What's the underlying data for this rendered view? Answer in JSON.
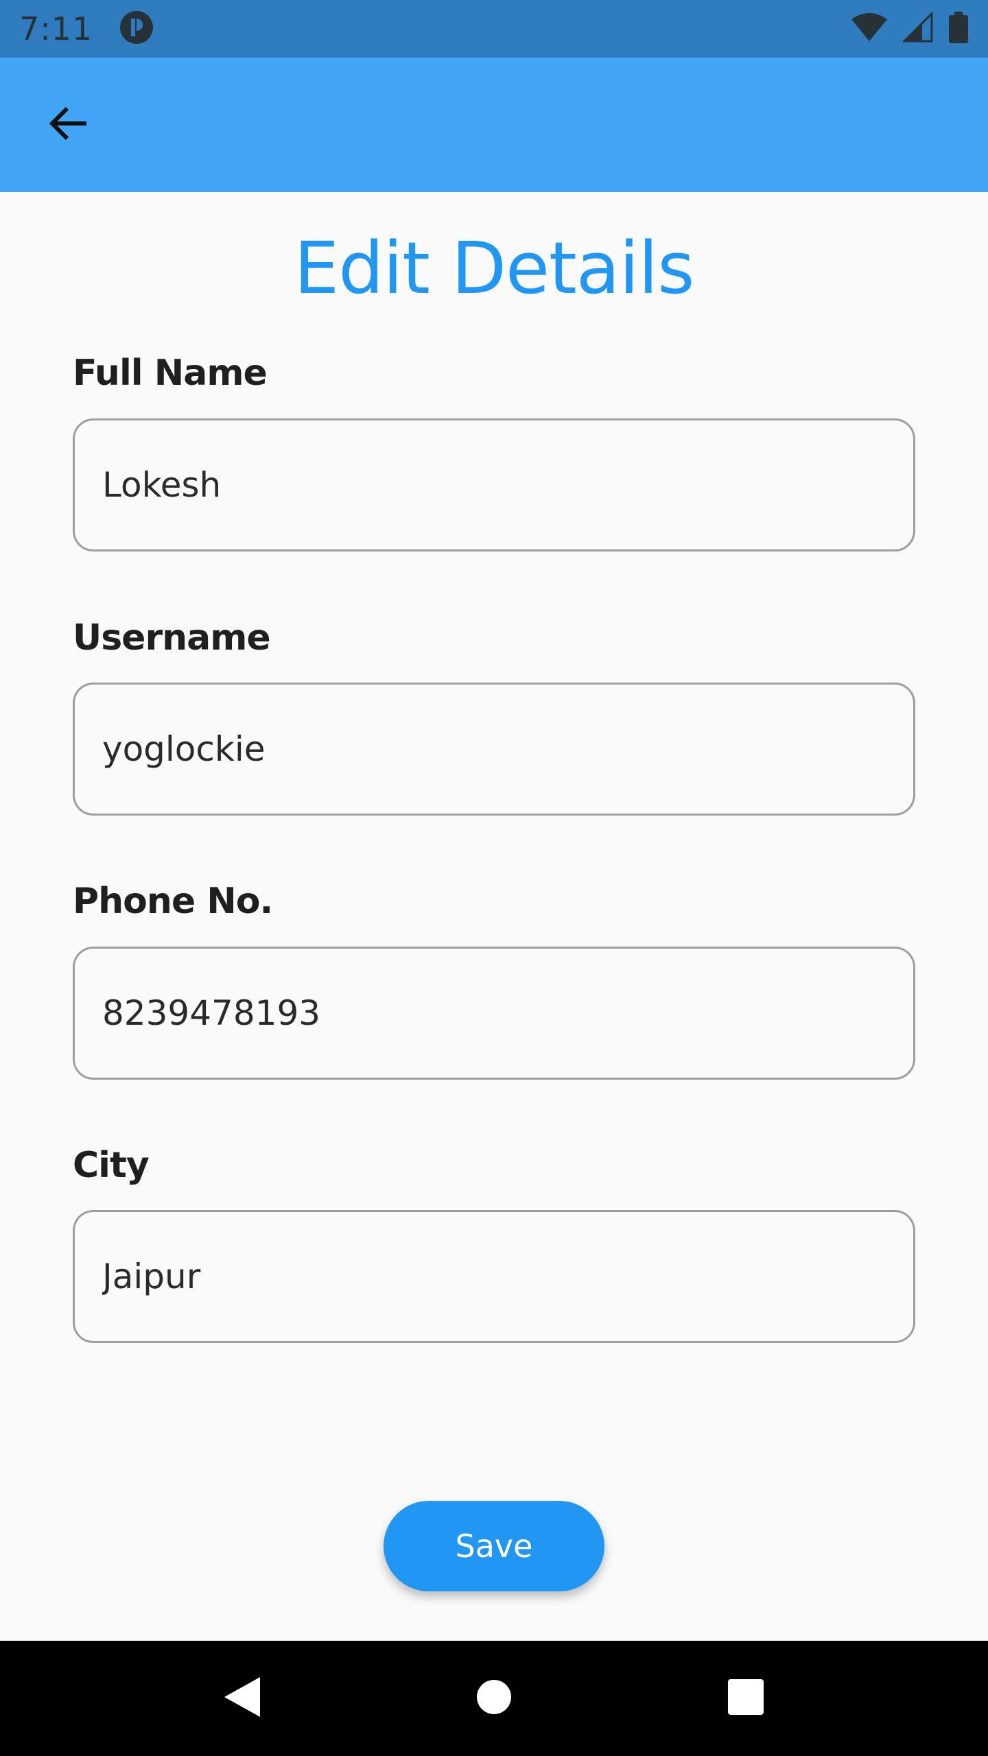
{
  "status_bar": {
    "time": "7:11",
    "icons": [
      "app-notification-icon",
      "wifi-icon",
      "signal-icon",
      "battery-icon"
    ]
  },
  "app_bar": {
    "back_icon": "arrow-back-icon"
  },
  "page": {
    "title": "Edit Details"
  },
  "form": {
    "full_name": {
      "label": "Full Name",
      "value": "Lokesh"
    },
    "username": {
      "label": "Username",
      "value": "yoglockie"
    },
    "phone": {
      "label": "Phone No.",
      "value": "8239478193"
    },
    "city": {
      "label": "City",
      "value": "Jaipur"
    }
  },
  "actions": {
    "save_label": "Save"
  },
  "nav_bar": {
    "icons": [
      "back-triangle-icon",
      "home-circle-icon",
      "recents-square-icon"
    ]
  },
  "colors": {
    "status_bar": "#2f7bbd",
    "app_bar": "#42a5f5",
    "accent": "#2196f3",
    "background": "#fafafa"
  }
}
